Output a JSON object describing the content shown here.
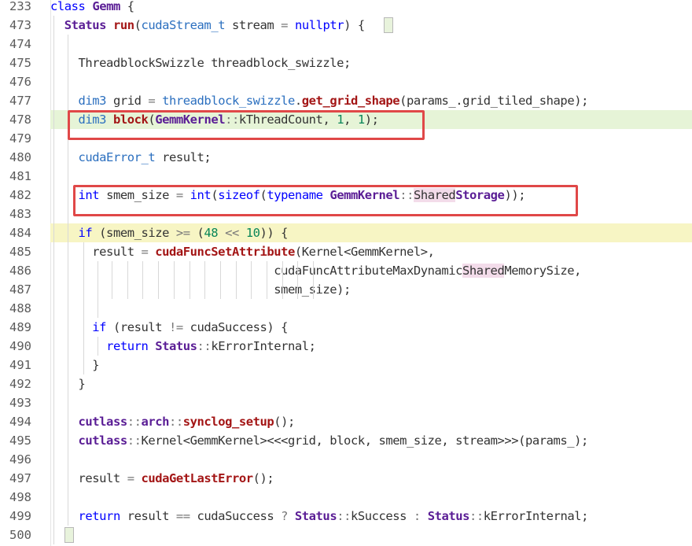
{
  "editor": {
    "lines": [
      {
        "num": "233",
        "tokens": [
          [
            "kw",
            "class"
          ],
          [
            "plain",
            " "
          ],
          [
            "cls",
            "Gemm"
          ],
          [
            "plain",
            " {"
          ]
        ]
      },
      {
        "num": "473",
        "tokens": [
          [
            "plain",
            "  "
          ],
          [
            "cls",
            "Status"
          ],
          [
            "plain",
            " "
          ],
          [
            "fn",
            "run"
          ],
          [
            "plain",
            "("
          ],
          [
            "ty",
            "cudaStream_t"
          ],
          [
            "plain",
            " stream "
          ],
          [
            "op",
            "="
          ],
          [
            "plain",
            " "
          ],
          [
            "kw",
            "nullptr"
          ],
          [
            "plain",
            ") {"
          ]
        ]
      },
      {
        "num": "474",
        "tokens": []
      },
      {
        "num": "475",
        "tokens": [
          [
            "plain",
            "    ThreadblockSwizzle threadblock_swizzle;"
          ]
        ]
      },
      {
        "num": "476",
        "tokens": []
      },
      {
        "num": "477",
        "tokens": [
          [
            "plain",
            "    "
          ],
          [
            "ty",
            "dim3"
          ],
          [
            "plain",
            " grid "
          ],
          [
            "op",
            "="
          ],
          [
            "plain",
            " "
          ],
          [
            "ty",
            "threadblock_swizzle"
          ],
          [
            "plain",
            "."
          ],
          [
            "fn",
            "get_grid_shape"
          ],
          [
            "plain",
            "(params_.grid_tiled_shape);"
          ]
        ]
      },
      {
        "num": "478",
        "tokens": [
          [
            "plain",
            "    "
          ],
          [
            "ty",
            "dim3"
          ],
          [
            "plain",
            " "
          ],
          [
            "fn",
            "block"
          ],
          [
            "plain",
            "("
          ],
          [
            "cls",
            "GemmKernel"
          ],
          [
            "op",
            "::"
          ],
          [
            "plain",
            "kThreadCount, "
          ],
          [
            "num",
            "1"
          ],
          [
            "plain",
            ", "
          ],
          [
            "num",
            "1"
          ],
          [
            "plain",
            ");"
          ]
        ]
      },
      {
        "num": "479",
        "tokens": []
      },
      {
        "num": "480",
        "tokens": [
          [
            "plain",
            "    "
          ],
          [
            "ty",
            "cudaError_t"
          ],
          [
            "plain",
            " result;"
          ]
        ]
      },
      {
        "num": "481",
        "tokens": []
      },
      {
        "num": "482",
        "tokens": [
          [
            "plain",
            "    "
          ],
          [
            "kw",
            "int"
          ],
          [
            "plain",
            " smem_size "
          ],
          [
            "op",
            "="
          ],
          [
            "plain",
            " "
          ],
          [
            "kw",
            "int"
          ],
          [
            "plain",
            "("
          ],
          [
            "kw",
            "sizeof"
          ],
          [
            "plain",
            "("
          ],
          [
            "kw",
            "typename"
          ],
          [
            "plain",
            " "
          ],
          [
            "cls",
            "GemmKernel"
          ],
          [
            "op",
            "::"
          ],
          [
            "sel",
            "Shared"
          ],
          [
            "cls",
            "Storage"
          ],
          [
            "plain",
            "));"
          ]
        ]
      },
      {
        "num": "483",
        "tokens": []
      },
      {
        "num": "484",
        "tokens": [
          [
            "plain",
            "    "
          ],
          [
            "kw",
            "if"
          ],
          [
            "plain",
            " (smem_size "
          ],
          [
            "op",
            ">="
          ],
          [
            "plain",
            " ("
          ],
          [
            "num",
            "48"
          ],
          [
            "plain",
            " "
          ],
          [
            "op",
            "<<"
          ],
          [
            "plain",
            " "
          ],
          [
            "num",
            "10"
          ],
          [
            "plain",
            ")) {"
          ]
        ]
      },
      {
        "num": "485",
        "tokens": [
          [
            "plain",
            "      result "
          ],
          [
            "op",
            "="
          ],
          [
            "plain",
            " "
          ],
          [
            "fn",
            "cudaFuncSetAttribute"
          ],
          [
            "plain",
            "(Kernel<GemmKernel>,"
          ]
        ]
      },
      {
        "num": "486",
        "tokens": [
          [
            "plain",
            "                                cudaFuncAttributeMaxDynamic"
          ],
          [
            "sel",
            "Shared"
          ],
          [
            "plain",
            "MemorySize,"
          ]
        ]
      },
      {
        "num": "487",
        "tokens": [
          [
            "plain",
            "                                smem_size);"
          ]
        ]
      },
      {
        "num": "488",
        "tokens": []
      },
      {
        "num": "489",
        "tokens": [
          [
            "plain",
            "      "
          ],
          [
            "kw",
            "if"
          ],
          [
            "plain",
            " (result "
          ],
          [
            "op",
            "!="
          ],
          [
            "plain",
            " cudaSuccess) {"
          ]
        ]
      },
      {
        "num": "490",
        "tokens": [
          [
            "plain",
            "        "
          ],
          [
            "kw",
            "return"
          ],
          [
            "plain",
            " "
          ],
          [
            "cls",
            "Status"
          ],
          [
            "op",
            "::"
          ],
          [
            "plain",
            "kErrorInternal;"
          ]
        ]
      },
      {
        "num": "491",
        "tokens": [
          [
            "plain",
            "      }"
          ]
        ]
      },
      {
        "num": "492",
        "tokens": [
          [
            "plain",
            "    }"
          ]
        ]
      },
      {
        "num": "493",
        "tokens": []
      },
      {
        "num": "494",
        "tokens": [
          [
            "plain",
            "    "
          ],
          [
            "cls",
            "cutlass"
          ],
          [
            "op",
            "::"
          ],
          [
            "cls",
            "arch"
          ],
          [
            "op",
            "::"
          ],
          [
            "fn",
            "synclog_setup"
          ],
          [
            "plain",
            "();"
          ]
        ]
      },
      {
        "num": "495",
        "tokens": [
          [
            "plain",
            "    "
          ],
          [
            "cls",
            "cutlass"
          ],
          [
            "op",
            "::"
          ],
          [
            "plain",
            "Kernel<GemmKernel><<<grid, block, smem_size, stream>>>(params_);"
          ]
        ]
      },
      {
        "num": "496",
        "tokens": []
      },
      {
        "num": "497",
        "tokens": [
          [
            "plain",
            "    result "
          ],
          [
            "op",
            "="
          ],
          [
            "plain",
            " "
          ],
          [
            "fn",
            "cudaGetLastError"
          ],
          [
            "plain",
            "();"
          ]
        ]
      },
      {
        "num": "498",
        "tokens": []
      },
      {
        "num": "499",
        "tokens": [
          [
            "plain",
            "    "
          ],
          [
            "kw",
            "return"
          ],
          [
            "plain",
            " result "
          ],
          [
            "op",
            "=="
          ],
          [
            "plain",
            " cudaSuccess "
          ],
          [
            "op",
            "?"
          ],
          [
            "plain",
            " "
          ],
          [
            "cls",
            "Status"
          ],
          [
            "op",
            "::"
          ],
          [
            "plain",
            "kSuccess "
          ],
          [
            "op",
            ":"
          ],
          [
            "plain",
            " "
          ],
          [
            "cls",
            "Status"
          ],
          [
            "op",
            "::"
          ],
          [
            "plain",
            "kErrorInternal;"
          ]
        ]
      },
      {
        "num": "500",
        "tokens": [
          [
            "plain",
            "  }"
          ]
        ]
      }
    ],
    "highlighted_line_green": "478",
    "highlighted_line_yellow": "484",
    "annotation_boxes": [
      "478",
      "482"
    ]
  }
}
